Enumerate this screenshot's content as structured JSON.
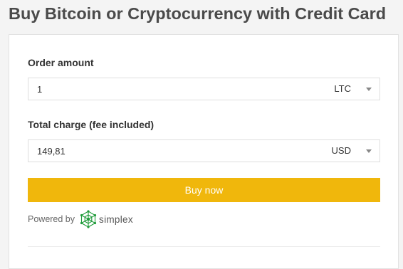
{
  "page": {
    "title": "Buy Bitcoin or Cryptocurrency with Credit Card"
  },
  "order_amount": {
    "label": "Order amount",
    "value": "1",
    "currency": "LTC"
  },
  "total_charge": {
    "label": "Total charge (fee included)",
    "value": "149,81",
    "currency": "USD"
  },
  "buy_button": {
    "label": "Buy now"
  },
  "powered_by": {
    "label": "Powered by",
    "brand": "simplex"
  },
  "colors": {
    "background": "#f4f4f4",
    "title_text": "#4a4a4a",
    "button_bg": "#f0b70c",
    "button_text": "#ffffff",
    "simplex_green": "#1f9b3a"
  },
  "icons": [
    "chevron-down-icon",
    "simplex-logo-icon"
  ]
}
